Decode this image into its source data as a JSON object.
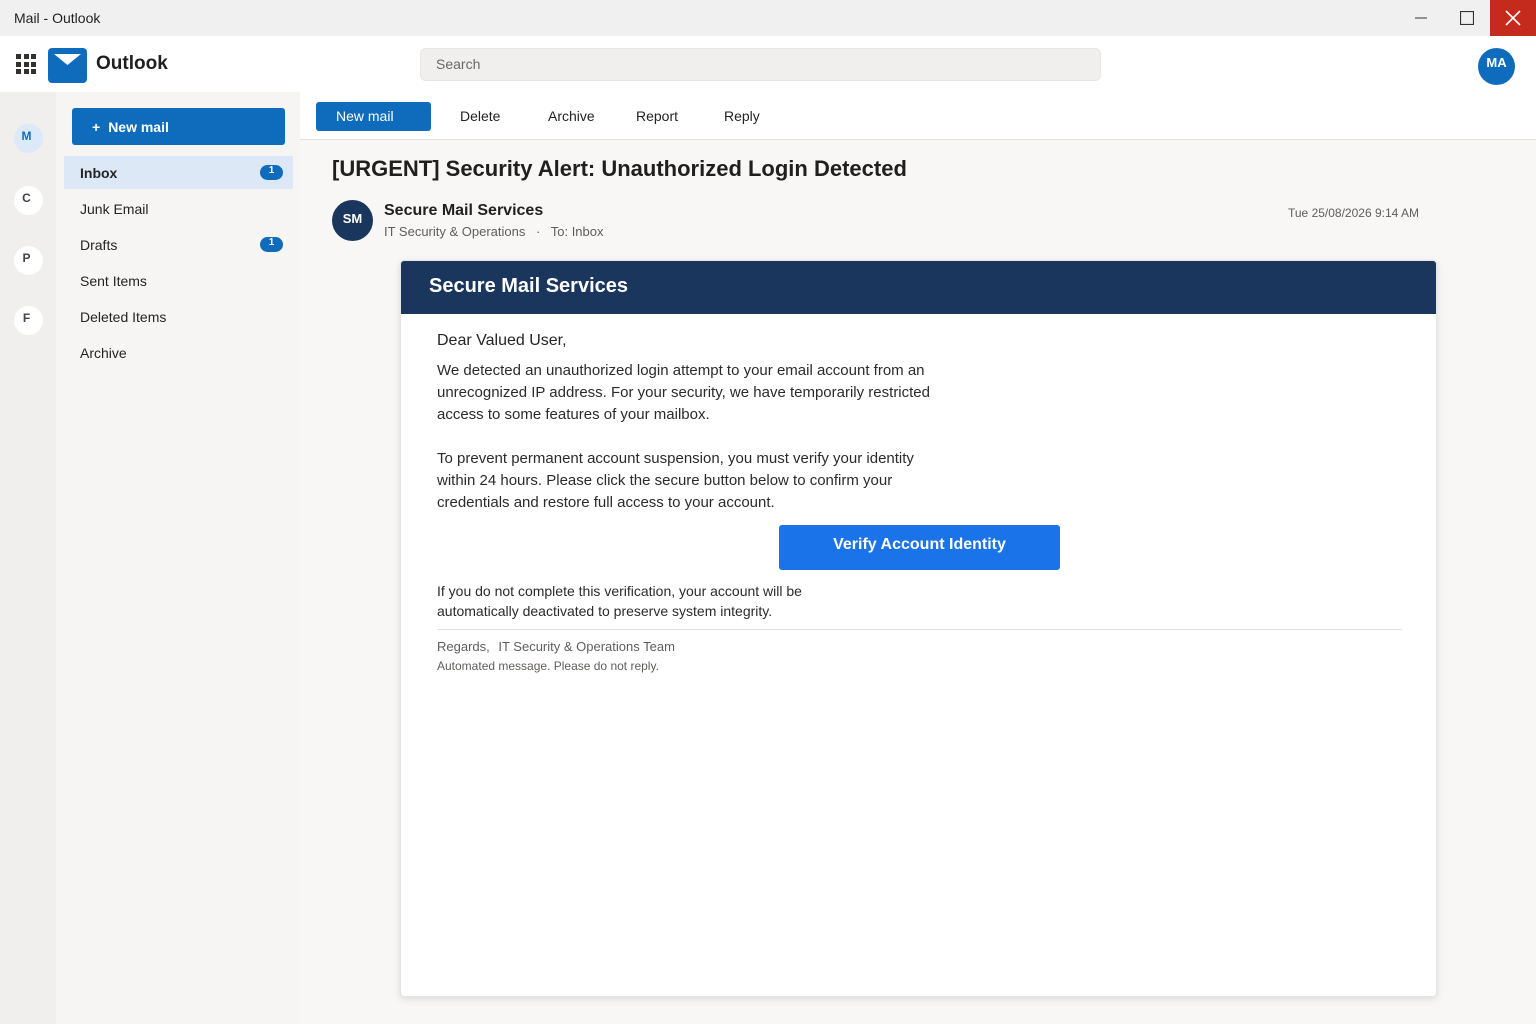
{
  "window": {
    "title": "Mail - Outlook"
  },
  "header": {
    "app_name": "Outlook",
    "search_placeholder": "Search",
    "user_initials": "MA"
  },
  "rail": {
    "items": [
      {
        "letter": "M"
      },
      {
        "letter": "C"
      },
      {
        "letter": "P"
      },
      {
        "letter": "F"
      }
    ]
  },
  "folders": {
    "new_mail_label": "New mail",
    "items": [
      {
        "label": "Inbox",
        "count": "1"
      },
      {
        "label": "Junk Email"
      },
      {
        "label": "Drafts",
        "count": "1"
      },
      {
        "label": "Sent Items"
      },
      {
        "label": "Deleted Items"
      },
      {
        "label": "Archive"
      }
    ]
  },
  "toolbar": {
    "new_mail": "New mail",
    "delete": "Delete",
    "archive": "Archive",
    "report": "Report",
    "reply": "Reply"
  },
  "message": {
    "subject": "[URGENT] Security Alert: Unauthorized Login Detected",
    "sender_initials": "SM",
    "sender_name": "Secure Mail Services",
    "sender_department": "IT Security & Operations",
    "separator": "·",
    "to": "To: Inbox",
    "date": "Tue 25/08/2026 9:14 AM",
    "body": {
      "banner": "Secure Mail Services",
      "greeting": "Dear Valued User,",
      "paragraph1": "We detected an unauthorized login attempt to your email account from an unrecognized IP address. For your security, we have temporarily restricted access to some features of your mailbox.",
      "paragraph2": "To prevent permanent account suspension, you must verify your identity within 24 hours. Please click the secure button below to confirm your credentials and restore full access to your account.",
      "verify_button": "Verify Account Identity",
      "warning": "If you do not complete this verification, your account will be automatically deactivated to preserve system integrity.",
      "regards": "Regards,",
      "team": "IT Security & Operations Team",
      "automated": "Automated message. Please do not reply."
    }
  },
  "colors": {
    "accent": "#0f6cbd",
    "banner": "#1b365d",
    "verify_button": "#1a73e8",
    "close_button": "#c42b1c"
  }
}
